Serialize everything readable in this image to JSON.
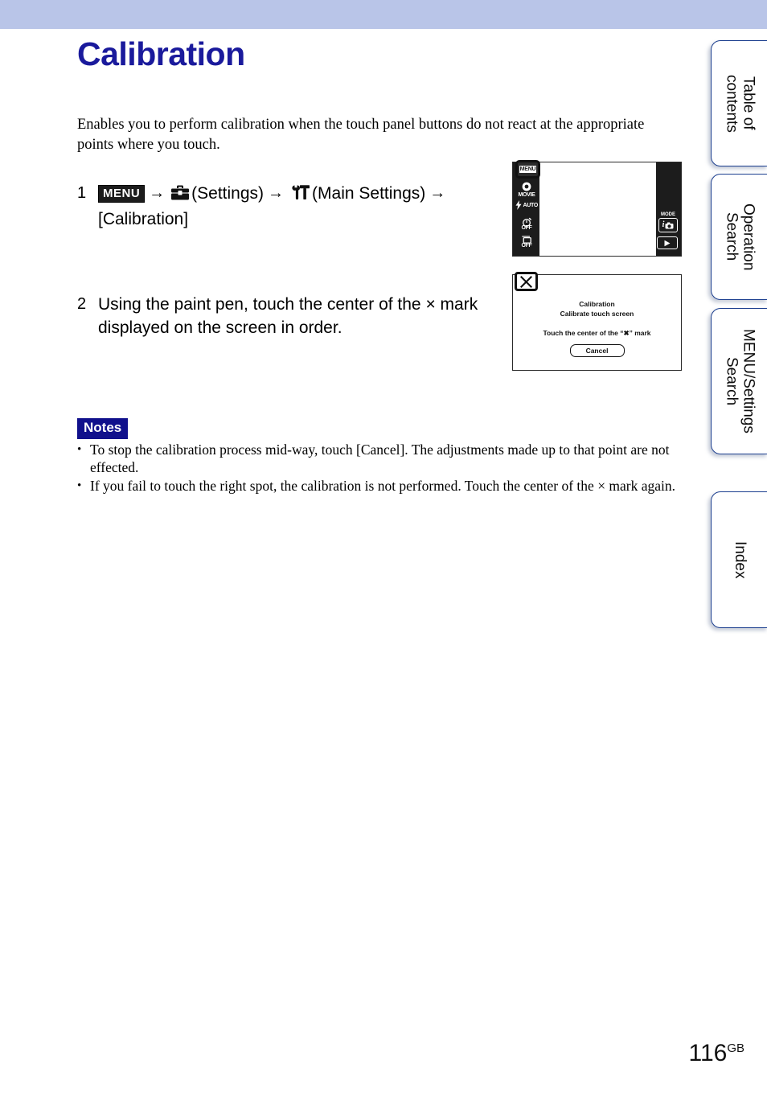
{
  "document": {
    "title": "Calibration",
    "intro": "Enables you to perform calibration when the touch panel buttons do not react at the appropriate points where you touch.",
    "page_number": "116",
    "page_number_suffix": "GB"
  },
  "steps": [
    {
      "number": "1",
      "menu_badge": "MENU",
      "arrow": "→",
      "settings_label": "(Settings)",
      "main_settings_label": "(Main Settings)",
      "target_label": "[Calibration]",
      "settings_icon": "toolbox-icon",
      "main_settings_icon": "wrench-hammer-icon"
    },
    {
      "number": "2",
      "text": "Using the paint pen, touch the center of the × mark displayed on the screen in order."
    }
  ],
  "notes": {
    "label": "Notes",
    "items": [
      "To stop the calibration process mid-way, touch [Cancel]. The adjustments made up to that point are not effected.",
      "If you fail to touch the right spot, the calibration is not performed. Touch the center of the × mark again."
    ]
  },
  "camera_screen": {
    "menu_button": "MENU",
    "left_icons": [
      {
        "icon": "movie-mode-icon",
        "label": "MOVIE"
      },
      {
        "icon": "flash-icon",
        "label": "AUTO"
      },
      {
        "icon": "self-timer-icon",
        "label": "OFF"
      },
      {
        "icon": "burst-mode-icon",
        "label": "OFF"
      }
    ],
    "mode_label": "MODE",
    "mode_value": "i",
    "mode_icon": "camera-iauto-icon",
    "playback_icon": "play-triangle-icon"
  },
  "calibration_dialog": {
    "close_icon": "close-x-icon",
    "line1": "Calibration",
    "line2": "Calibrate touch screen",
    "line3_prefix": "Touch the center of the “",
    "line3_mark": "✖",
    "line3_suffix": "” mark",
    "cancel_button": "Cancel"
  },
  "side_tabs": [
    {
      "label": "Table of\ncontents"
    },
    {
      "label": "Operation\nSearch"
    },
    {
      "label": "MENU/Settings\nSearch"
    },
    {
      "label": "Index"
    }
  ],
  "colors": {
    "top_band": "#b9c5e8",
    "title": "#1a1a9c",
    "notes_badge": "#10108c",
    "tab_border": "#1c3f8f"
  }
}
